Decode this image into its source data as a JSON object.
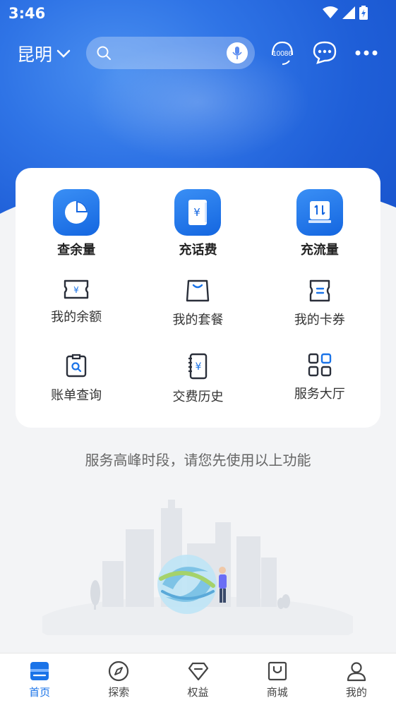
{
  "status_bar": {
    "time": "3:46"
  },
  "header": {
    "city": "昆明",
    "search_placeholder": "",
    "hotline_label": "10086"
  },
  "main_services": [
    {
      "label": "查余量",
      "icon": "pie-chart-icon"
    },
    {
      "label": "充话费",
      "icon": "yuan-phone-icon"
    },
    {
      "label": "充流量",
      "icon": "data-transfer-icon"
    }
  ],
  "sub_services_row1": [
    {
      "label": "我的余额",
      "icon": "yuan-ticket-icon"
    },
    {
      "label": "我的套餐",
      "icon": "shopping-bag-icon"
    },
    {
      "label": "我的卡券",
      "icon": "coupon-icon"
    }
  ],
  "sub_services_row2": [
    {
      "label": "账单查询",
      "icon": "bill-search-icon"
    },
    {
      "label": "交费历史",
      "icon": "payment-history-icon"
    },
    {
      "label": "服务大厅",
      "icon": "grid-icon"
    }
  ],
  "notice": "服务高峰时段，请您先使用以上功能",
  "tabs": [
    {
      "label": "首页",
      "icon": "home-icon",
      "active": true
    },
    {
      "label": "探索",
      "icon": "compass-icon",
      "active": false
    },
    {
      "label": "权益",
      "icon": "diamond-icon",
      "active": false
    },
    {
      "label": "商城",
      "icon": "shopping-bag-icon",
      "active": false
    },
    {
      "label": "我的",
      "icon": "user-icon",
      "active": false
    }
  ],
  "colors": {
    "brand_blue": "#1f5fd8",
    "active_tab": "#1a73e8"
  }
}
